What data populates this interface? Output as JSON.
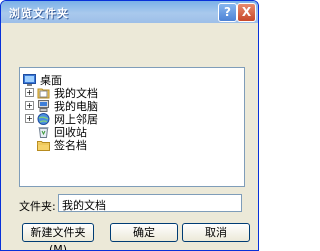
{
  "window": {
    "title": "浏览文件夹",
    "help_glyph": "?",
    "close_glyph": "X"
  },
  "tree": {
    "nodes": [
      {
        "label": "桌面",
        "icon": "desktop-icon"
      },
      {
        "label": "我的文档",
        "icon": "my-documents-icon",
        "expander": "+"
      },
      {
        "label": "我的电脑",
        "icon": "my-computer-icon",
        "expander": "+"
      },
      {
        "label": "网上邻居",
        "icon": "network-places-icon",
        "expander": "+"
      },
      {
        "label": "回收站",
        "icon": "recycle-bin-icon"
      },
      {
        "label": "签名档",
        "icon": "folder-icon"
      }
    ]
  },
  "folder_field": {
    "label": "文件夹:",
    "value": "我的文档"
  },
  "buttons": {
    "new_folder": "新建文件夹(M)",
    "ok": "确定",
    "cancel": "取消"
  },
  "colors": {
    "titlebar": "#9dbfe8",
    "dialog_bg": "#ece9d8",
    "border": "#0831d9"
  }
}
